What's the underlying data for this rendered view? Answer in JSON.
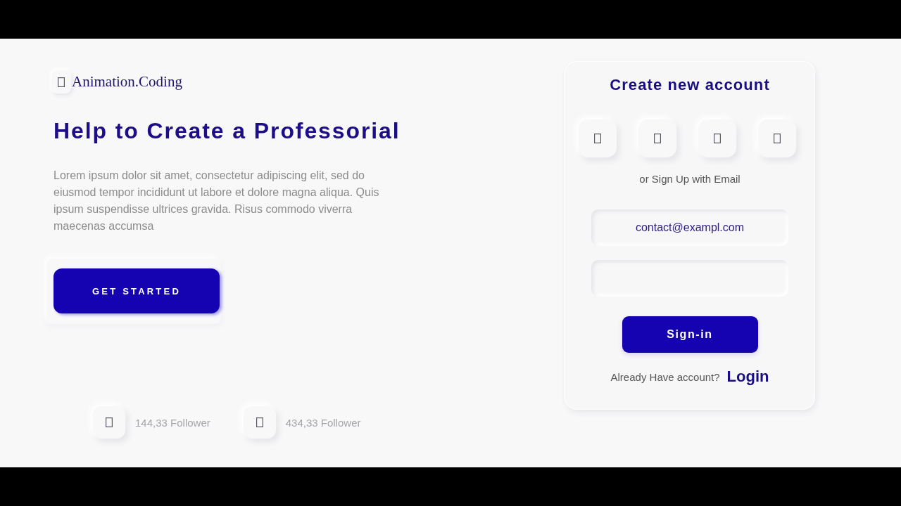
{
  "logo": {
    "text": "Animation.Coding"
  },
  "hero": {
    "title": "Help to Create a Professorial",
    "description": "Lorem ipsum dolor sit amet, consectetur adipiscing elit, sed do eiusmod tempor incididunt ut labore et dolore magna aliqua. Quis ipsum suspendisse ultrices gravida. Risus commodo viverra maecenas accumsa",
    "button": "GET STARTED"
  },
  "followers": [
    {
      "label": "144,33 Follower"
    },
    {
      "label": "434,33 Follower"
    }
  ],
  "signup_card": {
    "title": "Create new account",
    "divider_text": "or Sign Up with Email",
    "email_field": {
      "value": "contact@exampl.com"
    },
    "submit": "Sign-in",
    "login_prompt": "Already Have account?",
    "login_link": "Login"
  }
}
